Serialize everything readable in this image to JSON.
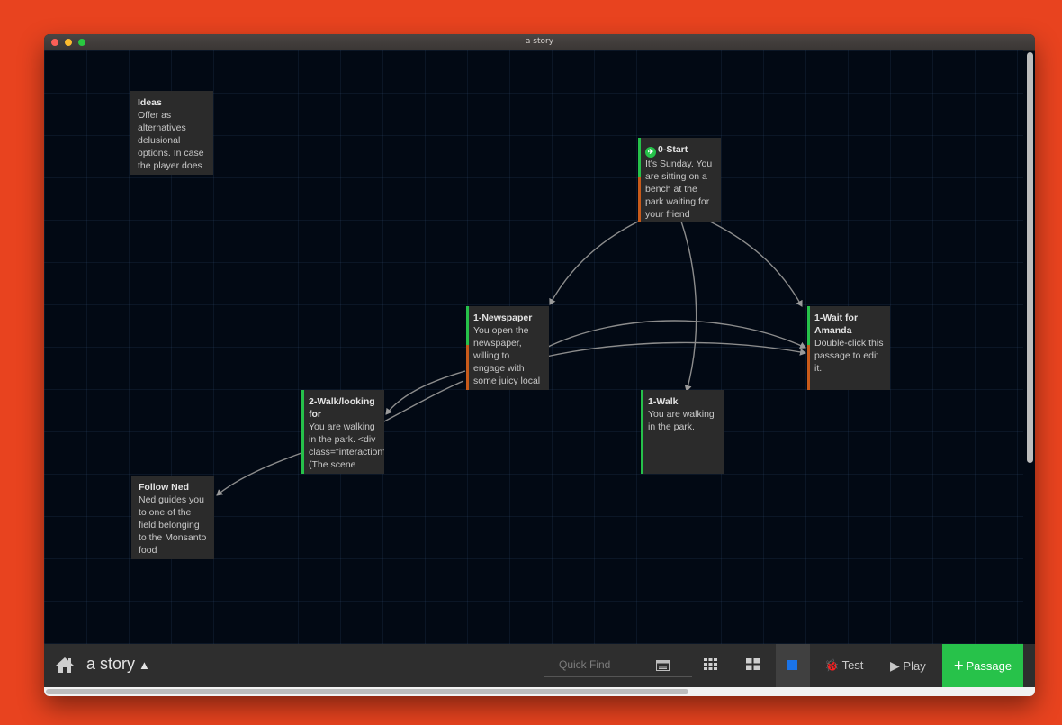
{
  "window": {
    "title": "a story"
  },
  "passages": {
    "ideas": {
      "title": "Ideas",
      "text": "Offer as alternatives delusional options. In case the player does"
    },
    "start": {
      "title": "0-Start",
      "text": "It's Sunday. You are sitting on a bench at the park waiting for your friend"
    },
    "newspaper": {
      "title": "1-Newspaper",
      "text": "You open the newspaper, willing to engage with some juicy local"
    },
    "wait": {
      "title": "1-Wait for Amanda",
      "text": "Double-click this passage to edit it."
    },
    "walking": {
      "title": "2-Walk/looking for",
      "text": "You are walking in the park. <div class=\"interaction\" (The scene"
    },
    "walk": {
      "title": "1-Walk",
      "text": "You are walking in the park."
    },
    "ned": {
      "title": "Follow Ned",
      "text": "Ned guides you to one of the field belonging to the Monsanto food"
    }
  },
  "toolbar": {
    "home_icon": "home-icon",
    "story_name": "a story",
    "story_caret": "▲",
    "search_placeholder": "Quick Find",
    "test_label": "Test",
    "play_label": "Play",
    "passage_label": "Passage",
    "passage_plus": "+"
  },
  "colors": {
    "background": "#e8431f",
    "canvas": "#020914",
    "passage_card": "#2b2b2b",
    "tag_green": "#26c14a",
    "tag_orange": "#c85a1a",
    "toolbar": "#2e2e2e",
    "add_button": "#27c24a",
    "zoom_active": "#1a73e8"
  }
}
